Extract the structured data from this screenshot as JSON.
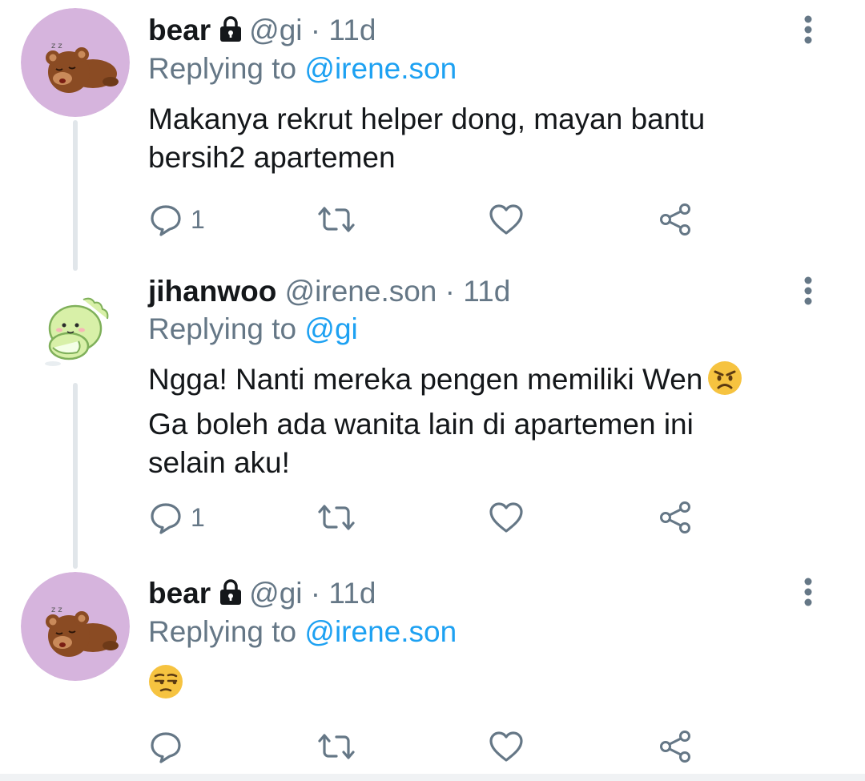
{
  "tweets": [
    {
      "name": "bear",
      "locked": true,
      "handle": "@gi",
      "separator": "·",
      "time": "11d",
      "replying_prefix": "Replying to",
      "replying_to": "@irene.son",
      "text": "Makanya rekrut helper dong, mayan bantu bersih2 apartemen",
      "reply_count": "1",
      "avatar_icon": "sleeping-bear-avatar"
    },
    {
      "name": "jihanwoo",
      "locked": false,
      "handle": "@irene.son",
      "separator": "·",
      "time": "11d",
      "replying_prefix": "Replying to",
      "replying_to": "@gi",
      "text_line1": "Ngga! Nanti mereka pengen memiliki Wen",
      "text_line2": "Ga boleh ada wanita lain di apartemen ini",
      "text_line3": "selain aku!",
      "reply_count": "1",
      "avatar_icon": "green-dino-avatar"
    },
    {
      "name": "bear",
      "locked": true,
      "handle": "@gi",
      "separator": "·",
      "time": "11d",
      "replying_prefix": "Replying to",
      "replying_to": "@irene.son",
      "text_emoji": "unamused-face-emoji",
      "reply_count": "",
      "avatar_icon": "sleeping-bear-avatar"
    }
  ],
  "colors": {
    "accent": "#1da1f2",
    "muted": "#657786",
    "thread_line": "#e1e6ea",
    "avatar_bg": "#d6b4dd"
  }
}
